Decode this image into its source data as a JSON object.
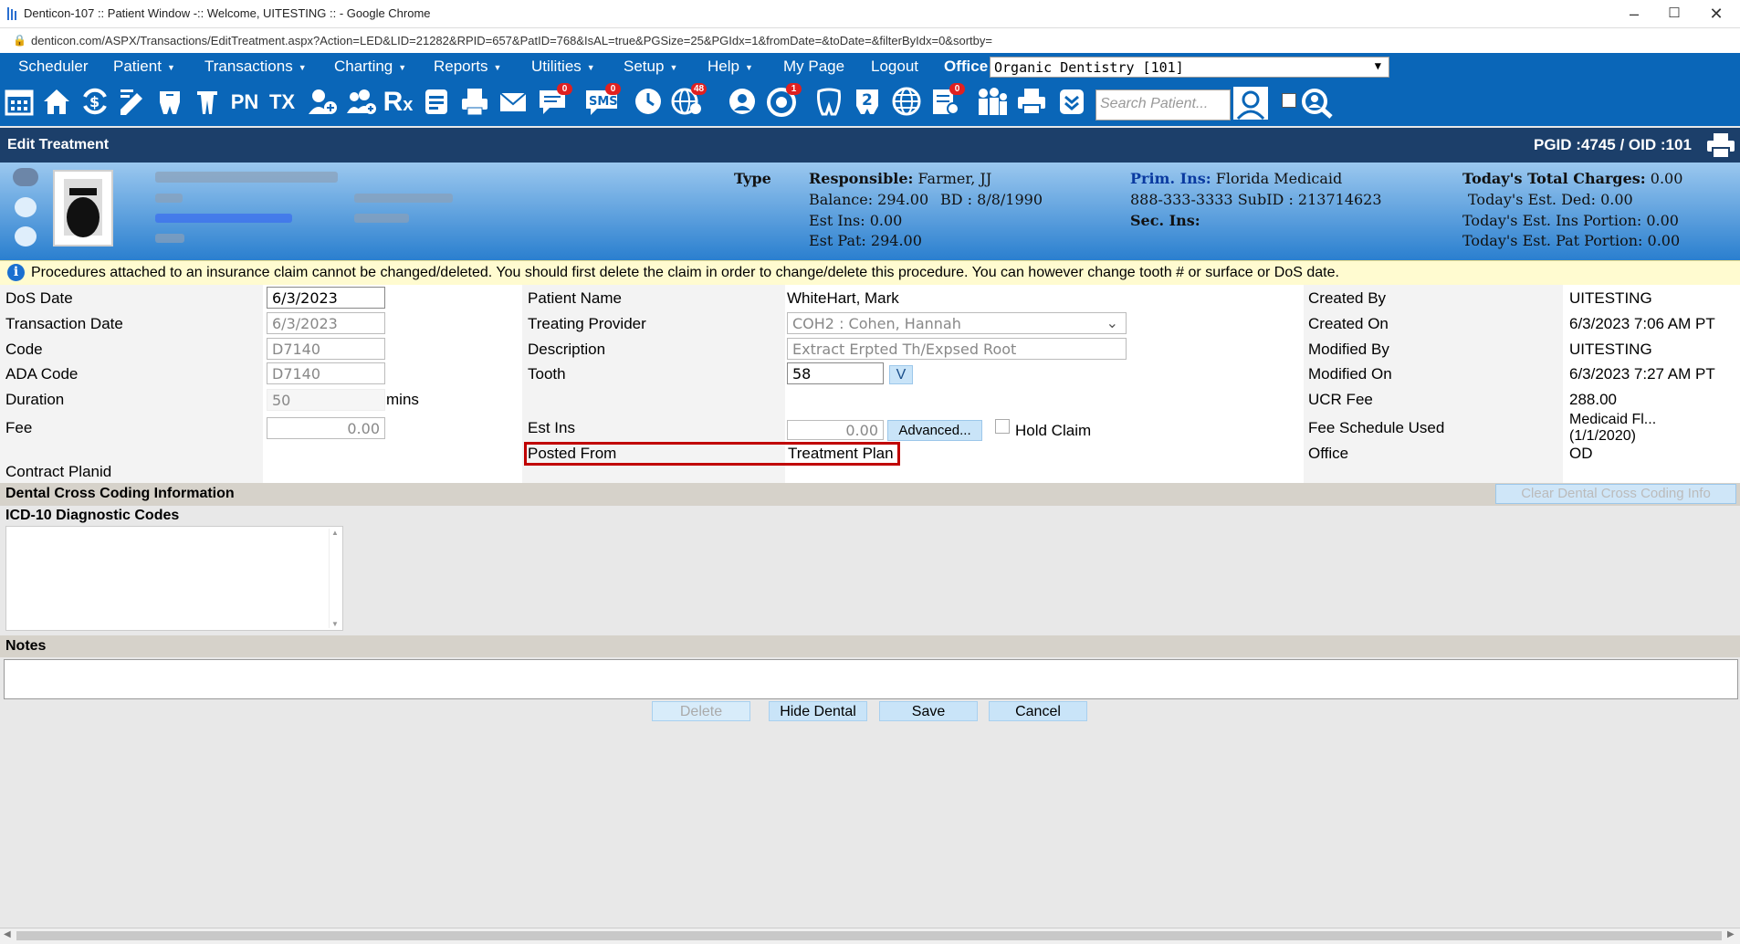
{
  "window": {
    "title": "Denticon-107 :: Patient Window -:: Welcome, UITESTING :: - Google Chrome",
    "url": "denticon.com/ASPX/Transactions/EditTreatment.aspx?Action=LED&LID=21282&RPID=657&PatID=768&IsAL=true&PGSize=25&PGIdx=1&fromDate=&toDate=&filterByIdx=0&sortby="
  },
  "menu": {
    "items": [
      "Scheduler",
      "Patient",
      "Transactions",
      "Charting",
      "Reports",
      "Utilities",
      "Setup",
      "Help",
      "My Page",
      "Logout"
    ],
    "office_label": "Office",
    "office_value": "Organic Dentistry [101]"
  },
  "toolbar": {
    "search_placeholder": "Search Patient...",
    "badges": {
      "chat": "0",
      "sms": "0",
      "web": "48",
      "alerts": "1",
      "forms": "0"
    },
    "icons": [
      "calendar-icon",
      "home-icon",
      "money-flow-icon",
      "edit-icon",
      "tooth-chart-icon",
      "tooth-icon",
      "pn-icon",
      "tx-icon",
      "add-patient-icon",
      "add-family-icon",
      "rx-icon",
      "document-icon",
      "print-doc-icon",
      "mail-icon",
      "chat-icon",
      "sms-icon",
      "clock-icon",
      "web-icon",
      "support-icon",
      "alerts-icon",
      "tooth-outline-icon",
      "tooth-help-icon",
      "globe-icon",
      "forms-icon",
      "family-icon",
      "printer-icon",
      "checklist-icon"
    ]
  },
  "section": {
    "title": "Edit Treatment",
    "ids": "PGID :4745  /  OID :101"
  },
  "patient": {
    "type_label": "Type",
    "responsible_label": "Responsible:",
    "responsible_value": "Farmer, JJ",
    "balance": "Balance: 294.00",
    "bd": "BD : 8/8/1990",
    "est_ins": "Est Ins:  0.00",
    "est_pat": "Est Pat: 294.00",
    "prim_ins_label": "Prim. Ins:",
    "prim_ins_value": "Florida Medicaid",
    "phone_sub": "888-333-3333 SubID : 213714623",
    "sec_ins_label": "Sec. Ins:",
    "today_total_label": "Today's Total Charges:",
    "today_total_value": "0.00",
    "today_ded": "Today's Est. Ded:   0.00",
    "today_ins": "Today's Est. Ins Portion: 0.00",
    "today_pat": "Today's Est. Pat Portion: 0.00"
  },
  "warning": "Procedures attached to an insurance claim cannot be changed/deleted. You should first delete the claim in order to change/delete this procedure. You can however change tooth # or surface or DoS date.",
  "form": {
    "dos_label": "DoS Date",
    "dos_value": "6/3/2023",
    "txdate_label": "Transaction Date",
    "txdate_value": "6/3/2023",
    "code_label": "Code",
    "code_value": "D7140",
    "ada_label": "ADA Code",
    "ada_value": "D7140",
    "duration_label": "Duration",
    "duration_value": "50",
    "duration_unit": "mins",
    "fee_label": "Fee",
    "fee_value": "0.00",
    "contract_label": "Contract Planid",
    "patient_name_label": "Patient Name",
    "patient_name_value": "WhiteHart, Mark",
    "provider_label": "Treating Provider",
    "provider_value": "COH2 : Cohen, Hannah",
    "description_label": "Description",
    "description_value": "Extract Erpted Th/Expsed Root",
    "tooth_label": "Tooth",
    "tooth_value": "58",
    "tooth_btn": "V",
    "est_ins_label": "Est Ins",
    "est_ins_value": "0.00",
    "advanced_btn": "Advanced...",
    "hold_claim": "Hold Claim",
    "posted_label": "Posted From",
    "posted_value": "Treatment Plan",
    "created_by_label": "Created By",
    "created_by_value": "UITESTING",
    "created_on_label": "Created On",
    "created_on_value": "6/3/2023 7:06 AM PT",
    "modified_by_label": "Modified By",
    "modified_by_value": "UITESTING",
    "modified_on_label": "Modified On",
    "modified_on_value": "6/3/2023 7:27 AM PT",
    "ucr_label": "UCR Fee",
    "ucr_value": "288.00",
    "fee_schedule_label": "Fee Schedule Used",
    "fee_schedule_value": "Medicaid Fl...",
    "fee_schedule_date": "(1/1/2020)",
    "office_label": "Office",
    "office_value": "OD"
  },
  "cross_coding": {
    "title": "Dental Cross Coding Information",
    "clear_btn": "Clear Dental Cross Coding Info"
  },
  "icd": {
    "title": "ICD-10 Diagnostic Codes"
  },
  "notes": {
    "title": "Notes"
  },
  "actions": {
    "delete": "Delete",
    "hide_dental": "Hide Dental",
    "save": "Save",
    "cancel": "Cancel"
  }
}
